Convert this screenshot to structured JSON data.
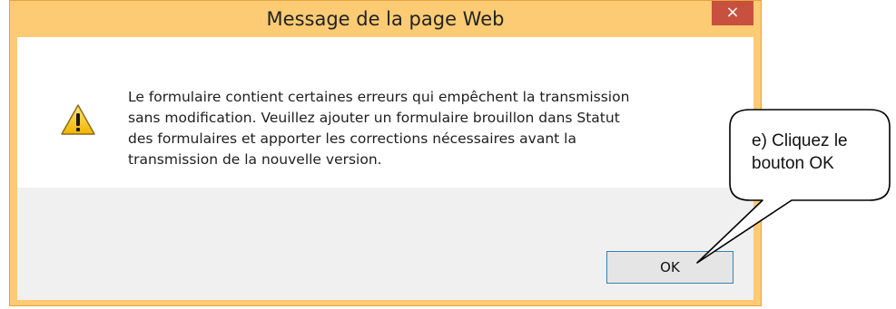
{
  "dialog": {
    "title": "Message de la page Web",
    "close_label": "×",
    "icon": "warning-triangle-icon",
    "message_lines": [
      "Le formulaire contient certaines erreurs qui empêchent la transmission",
      "sans modification. Veuillez ajouter un formulaire brouillon dans Statut",
      "des formulaires et apporter les corrections nécessaires avant la",
      "transmission de la nouvelle version."
    ],
    "ok_label": "OK"
  },
  "callout": {
    "text": "e) Cliquez le\nbouton OK"
  },
  "colors": {
    "frame": "#fccb73",
    "close_button": "#c7503f",
    "footer": "#f0f0f0",
    "ok_border": "#3c7fb1"
  }
}
